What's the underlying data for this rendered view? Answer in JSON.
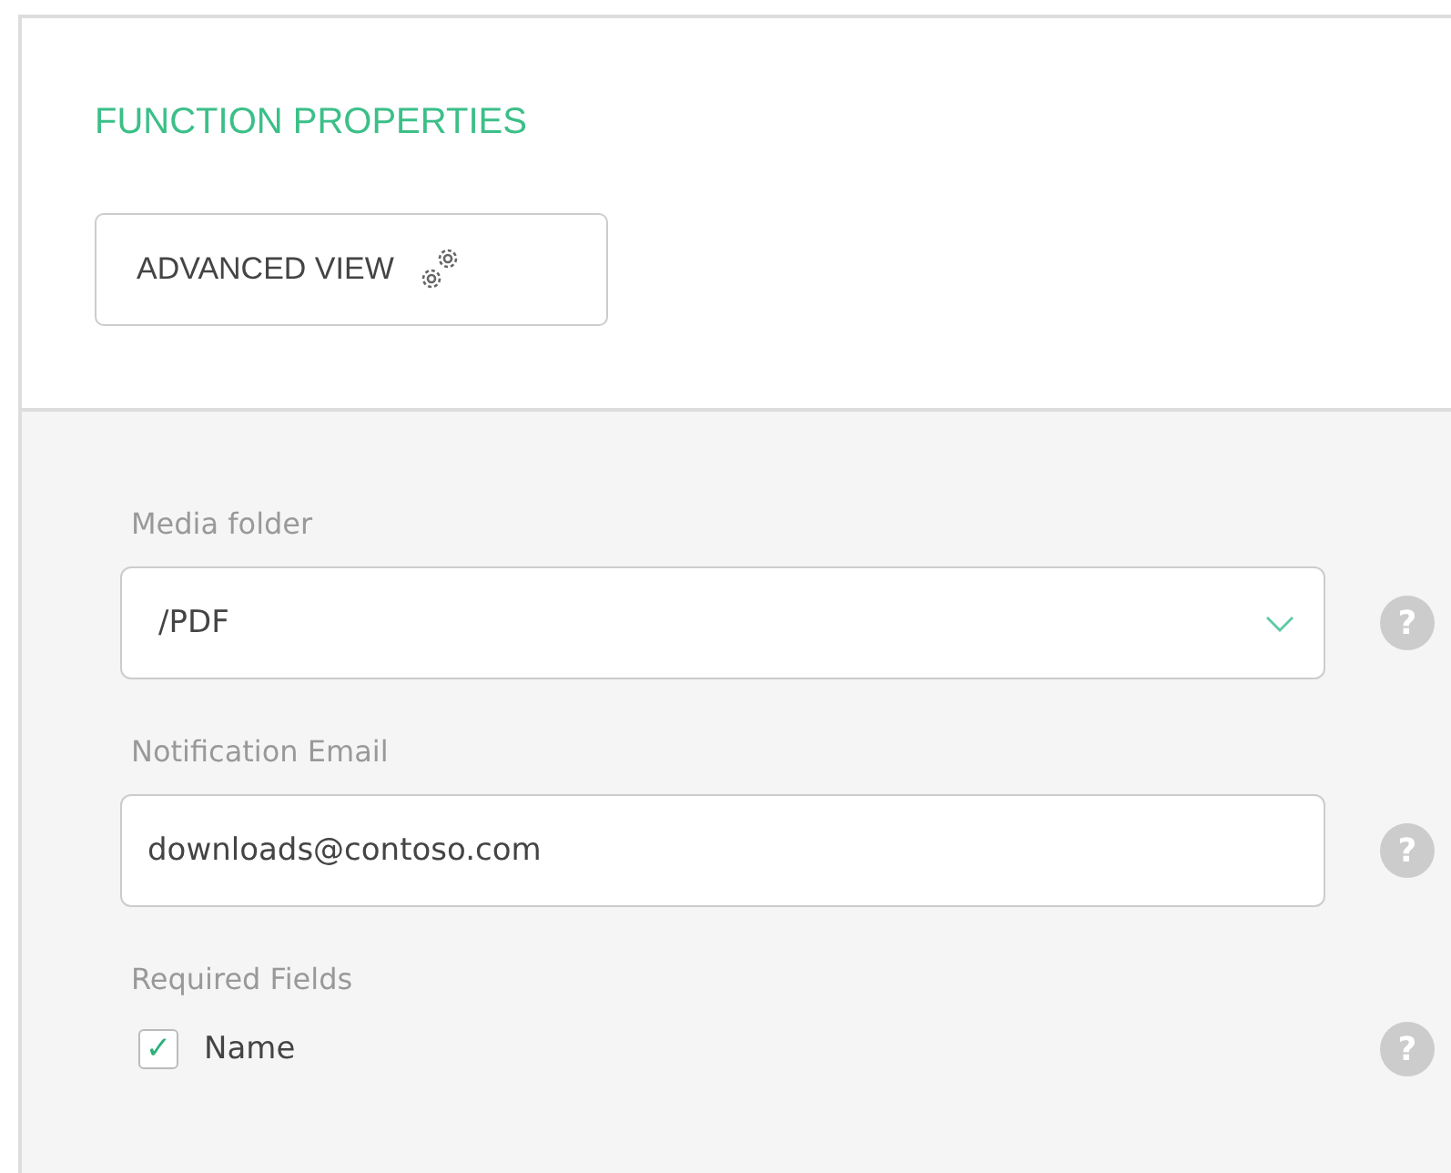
{
  "panel": {
    "title": "FUNCTION PROPERTIES",
    "advanced_button": "ADVANCED VIEW"
  },
  "fields": [
    {
      "kind": "select",
      "label": "Media folder",
      "value": "/PDF",
      "help": "?"
    },
    {
      "kind": "text",
      "label": "Notification Email",
      "value": "downloads@contoso.com",
      "help": "?"
    },
    {
      "kind": "checklist",
      "label": "Required Fields",
      "options": [
        {
          "label": "Name",
          "checked": true,
          "check_mark": "✓",
          "help": "?"
        }
      ]
    }
  ]
}
